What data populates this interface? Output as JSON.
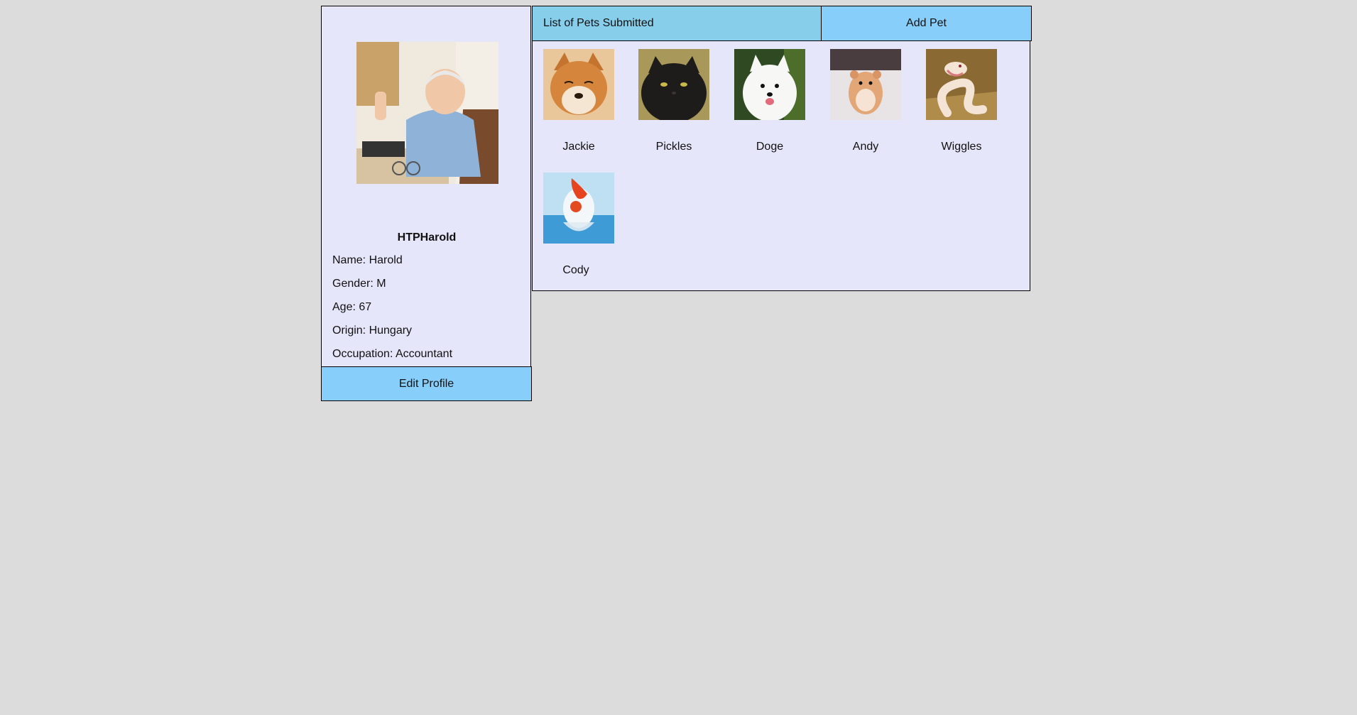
{
  "profile": {
    "username": "HTPHarold",
    "fields": [
      {
        "label": "Name: ",
        "value": "Harold"
      },
      {
        "label": "Gender: ",
        "value": "M"
      },
      {
        "label": "Age: ",
        "value": "67"
      },
      {
        "label": "Origin: ",
        "value": "Hungary"
      },
      {
        "label": "Occupation: ",
        "value": "Accountant"
      }
    ],
    "edit_label": "Edit Profile"
  },
  "tabs": {
    "list_label": "List of Pets Submitted",
    "add_label": "Add Pet"
  },
  "pets": [
    {
      "name": "Jackie"
    },
    {
      "name": "Pickles"
    },
    {
      "name": "Doge"
    },
    {
      "name": "Andy"
    },
    {
      "name": "Wiggles"
    },
    {
      "name": "Cody"
    }
  ],
  "colors": {
    "page_bg": "#dcdcdc",
    "panel_bg": "#e6e6fa",
    "button_bg": "#87cefa",
    "tab_active_bg": "#87ceeb"
  }
}
